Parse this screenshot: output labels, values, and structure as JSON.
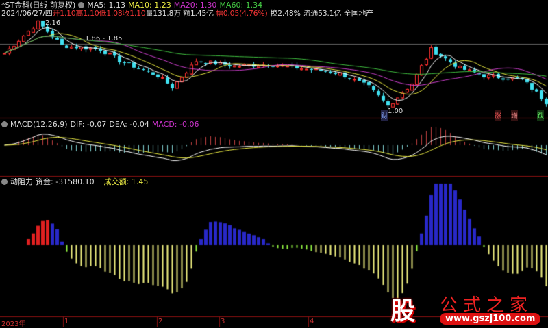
{
  "header": {
    "name": "*ST金科(日线 前复权)",
    "ma5": "MA5: 1.13",
    "ma10": "MA10: 1.23",
    "ma20": "MA20: 1.30",
    "ma60": "MA60: 1.34"
  },
  "quote": {
    "date": "2024/06/27/四",
    "open_l": "开",
    "open": "1.10",
    "high_l": "高",
    "high": "1.10",
    "low_l": "低",
    "low": "1.08",
    "close_l": "收",
    "close": "1.10",
    "vol": "量131.8万",
    "amt": "额1.45亿",
    "chg_l": "幅",
    "chg": "0.05(4.76%)",
    "turn": "换2.48%",
    "float": "流通53.1亿",
    "sector": "全国地产"
  },
  "annotations": {
    "high": "2.16",
    "range": "1.86 - 1.85",
    "low": "1.00",
    "cai": "财",
    "zhang": "涨",
    "zeng": "增",
    "die": "跌"
  },
  "macd": {
    "title": "MACD(12,26,9)",
    "dif": "DIF: -0.07",
    "dea": "DEA: -0.04",
    "macd": "MACD: -0.06"
  },
  "ind": {
    "title": "动阻力",
    "fund": "资金: -31580.10",
    "amt": "成交额: 1.45"
  },
  "axis": {
    "year": "2023年",
    "months": [
      "1",
      "2",
      "3",
      "4"
    ]
  },
  "logo": {
    "gu": "股",
    "text": "公式之家",
    "url": "www.gszj100.com"
  },
  "colors": {
    "up": "#ff3030",
    "down": "#40e0f0",
    "ma5": "#ffffff",
    "ma10": "#e8e840",
    "ma20": "#d040d0",
    "ma60": "#40c040"
  },
  "chart_data": {
    "type": "candlestick",
    "price_range": [
      1.0,
      2.16
    ],
    "close_keypoints": [
      [
        0,
        1.75
      ],
      [
        7,
        2.16
      ],
      [
        12,
        1.85
      ],
      [
        20,
        1.8
      ],
      [
        24,
        1.65
      ],
      [
        32,
        1.45
      ],
      [
        35,
        1.3
      ],
      [
        40,
        1.65
      ],
      [
        48,
        1.58
      ],
      [
        55,
        1.6
      ],
      [
        62,
        1.55
      ],
      [
        70,
        1.48
      ],
      [
        76,
        1.3
      ],
      [
        80,
        1.05
      ],
      [
        85,
        1.35
      ],
      [
        89,
        1.8
      ],
      [
        95,
        1.55
      ],
      [
        100,
        1.45
      ],
      [
        108,
        1.4
      ],
      [
        113,
        1.1
      ]
    ],
    "bars": 114
  }
}
